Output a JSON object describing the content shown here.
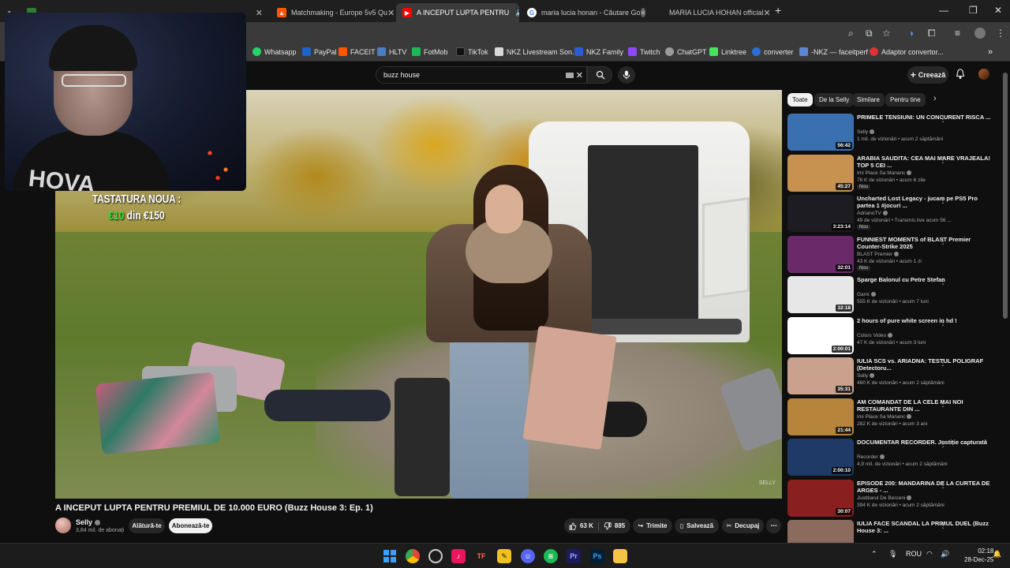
{
  "browser": {
    "tabs": [
      {
        "label": "",
        "active": false
      },
      {
        "label": "",
        "active": false
      },
      {
        "label": "Matchmaking - Europe 5v5 Qu",
        "active": false
      },
      {
        "label": "A INCEPUT LUPTA PENTRU",
        "active": true
      },
      {
        "label": "maria lucia honan - Căutare Go",
        "active": false
      },
      {
        "label": "MARIA LUCIA HOHAN official",
        "active": false
      }
    ],
    "new_tab": "+",
    "bookmarks": [
      "Whatsapp",
      "PayPal",
      "FACEIT",
      "HLTV",
      "FotMob",
      "TikTok",
      "NKZ Livestream Son...",
      "NKZ Family",
      "Twitch",
      "ChatGPT",
      "Linktree",
      "converter",
      "-NKZ — faceitperf",
      "Adaptor convertor..."
    ],
    "bookmark_colors": [
      "#25d366",
      "#1a63c7",
      "#ff5500",
      "#4b7fbf",
      "#1db954",
      "#111111",
      "#d8d8d8",
      "#2b5cd8",
      "#9146ff",
      "#9a9a9a",
      "#43e55e",
      "#2a6fd6",
      "#5b86d8",
      "#d33"
    ]
  },
  "youtube": {
    "search_query": "buzz house",
    "create_label": "Creează",
    "chips": [
      "Toate",
      "De la Selly",
      "Similare",
      "Pentru tine"
    ],
    "video": {
      "title": "A INCEPUT LUPTA PENTRU PREMIUL DE 10.000 EURO (Buzz House 3: Ep. 1)",
      "overlay_line1": "TASTATURA NOUA :",
      "overlay_amount": "€10",
      "overlay_rest": " din €150",
      "watermark": "SELLY",
      "webcam_shirt_text": "HOVA"
    },
    "channel": {
      "name": "Selly",
      "subscribers": "3,84 mil. de abonați",
      "join_label": "Alăturǎ-te",
      "subscribe_label": "Abonează-te"
    },
    "actions": {
      "likes": "63 K",
      "dislikes": "885",
      "share": "Trimite",
      "save": "Salvează",
      "clip": "Decupaj"
    },
    "recommendations": [
      {
        "title": "PRIMELE TENSIUNI: UN CONCURENT RISCA ...",
        "channel": "Selly",
        "meta": "1 mil. de vizionări • acum 2 săptămâni",
        "duration": "56:42",
        "badge": "",
        "color": "#3a6fb0"
      },
      {
        "title": "ARABIA SAUDITA: CEA MAI MARE VRAJEALA! TOP 5 CEI ...",
        "channel": "Imi Place Sa Mananc",
        "meta": "76 K de vizionări • acum 6 zile",
        "duration": "45:27",
        "badge": "Nou",
        "color": "#c79150"
      },
      {
        "title": "Uncharted Lost Legacy - jucam pe PS5 Pro partea 1 #jocuri ...",
        "channel": "AdrianoTV",
        "meta": "49 de vizionări • Transmis live acum 56 ...",
        "duration": "3:23:14",
        "badge": "Nou",
        "color": "#1c1c22"
      },
      {
        "title": "FUNNIEST MOMENTS of BLAST Premier Counter-Strike 2025",
        "channel": "BLAST Premier",
        "meta": "43 K de vizionări • acum 1 zi",
        "duration": "32:01",
        "badge": "Nou",
        "color": "#6a2a6a"
      },
      {
        "title": "Sparge Balonul cu Petre Stefan",
        "channel": "Gami",
        "meta": "555 K de vizionări • acum 7 luni",
        "duration": "32:18",
        "badge": "",
        "color": "#e7e7e7"
      },
      {
        "title": "2 hours of pure white screen in hd !",
        "channel": "Colors Video",
        "meta": "47 K de vizionări • acum 3 luni",
        "duration": "2:00:01",
        "badge": "",
        "color": "#ffffff"
      },
      {
        "title": "IULIA SCS vs. ARIADNA: TESTUL POLIGRAF (Detectoru...",
        "channel": "Selly",
        "meta": "460 K de vizionări • acum 2 săptămâni",
        "duration": "35:31",
        "badge": "",
        "color": "#c9a18c"
      },
      {
        "title": "AM COMANDAT DE LA CELE MAI NOI RESTAURANTE DIN ...",
        "channel": "Imi Place Sa Mananc",
        "meta": "282 K de vizionări • acum 3 ani",
        "duration": "21:44",
        "badge": "",
        "color": "#b7843c"
      },
      {
        "title": "DOCUMENTAR RECORDER. Justiție capturată",
        "channel": "Recorder",
        "meta": "4,9 mil. de vizionări • acum 2 săptămâni",
        "duration": "2:00:10",
        "badge": "",
        "color": "#1f3a66"
      },
      {
        "title": "EPISODE 200: MANDARINA DE LA CURTEA DE ARGES - ...",
        "channel": "Justitiarul De Berceni",
        "meta": "394 K de vizionări • acum 2 săptămâni",
        "duration": "30:07",
        "badge": "",
        "color": "#8a1f1f"
      },
      {
        "title": "IULIA FACE SCANDAL LA PRIMUL DUEL (Buzz House 3: ...",
        "channel": "",
        "meta": "",
        "duration": "",
        "badge": "",
        "color": "#8b6b5d"
      }
    ]
  },
  "taskbar": {
    "language": "ROU",
    "time": "02:18",
    "date": "28-Dec-25"
  }
}
